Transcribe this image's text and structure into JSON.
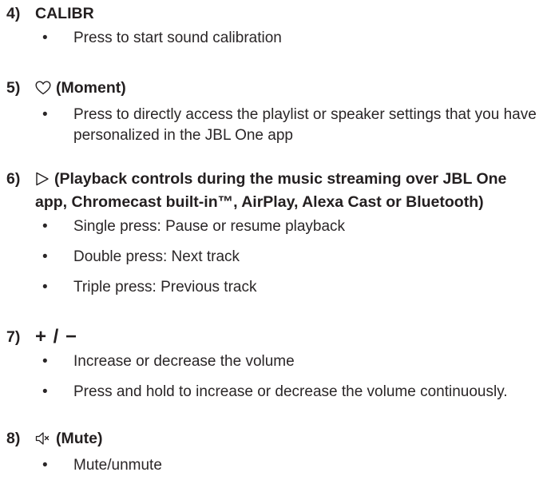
{
  "sections": [
    {
      "number": "4)",
      "title": "CALIBR",
      "bullets": [
        "Press to start sound calibration"
      ]
    },
    {
      "number": "5)",
      "icon": "heart-outline-icon",
      "title": "(Moment)",
      "bullets": [
        "Press to directly access the playlist or speaker settings that you have personalized in the JBL One app"
      ]
    },
    {
      "number": "6)",
      "icon": "play-outline-icon",
      "title": "(Playback controls during the music streaming over JBL One app, Chromecast built-in™, AirPlay, Alexa Cast or Bluetooth)",
      "bullets": [
        "Single press: Pause or resume playback",
        "Double press: Next track",
        "Triple press: Previous track"
      ]
    },
    {
      "number": "7)",
      "title": "+ / −",
      "bullets": [
        "Increase or decrease the volume",
        "Press and hold to increase or decrease the volume continuously."
      ]
    },
    {
      "number": "8)",
      "icon": "speaker-mute-icon",
      "title": "(Mute)",
      "bullets": [
        "Mute/unmute"
      ]
    }
  ]
}
